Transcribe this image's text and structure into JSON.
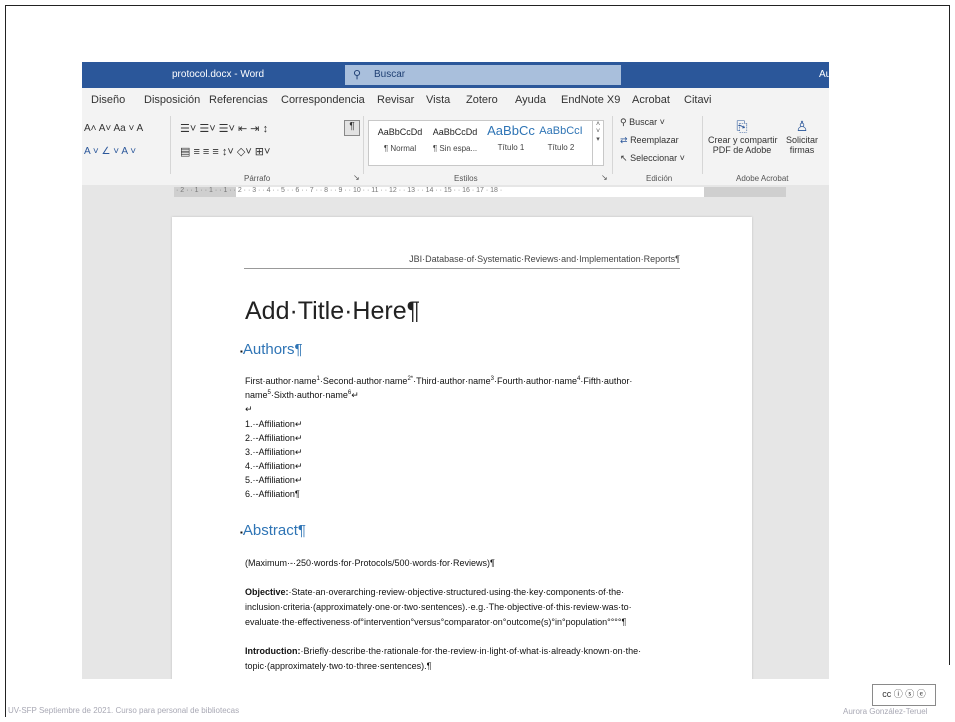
{
  "titlebar": {
    "doc_name": "protocol.docx - Word",
    "search_placeholder": "Buscar",
    "user_initial": "Au"
  },
  "tabs": [
    "Diseño",
    "Disposición",
    "Referencias",
    "Correspondencia",
    "Revisar",
    "Vista",
    "Zotero",
    "Ayuda",
    "EndNote X9",
    "Acrobat",
    "Citavi"
  ],
  "ribbon": {
    "font_row1": "A˄ A˅  Aa ˅  A",
    "font_row2": "A ˅  ∠ ˅  A ˅",
    "para_group": "Párrafo",
    "styles": [
      {
        "preview": "AaBbCcDd",
        "name": "¶ Normal"
      },
      {
        "preview": "AaBbCcDd",
        "name": "¶ Sin espa..."
      },
      {
        "preview": "AaBbCc",
        "name": "Título 1"
      },
      {
        "preview": "AaBbCcI",
        "name": "Título 2"
      }
    ],
    "styles_group": "Estilos",
    "edit": {
      "find": "Buscar",
      "replace": "Reemplazar",
      "select": "Seleccionar",
      "group": "Edición"
    },
    "acrobat": {
      "create_line1": "Crear y compartir",
      "create_line2": "PDF de Adobe",
      "request_line1": "Solicitar",
      "request_line2": "firmas",
      "group": "Adobe Acrobat"
    }
  },
  "ruler": {
    "ticks": "· 2 · · 1 · · 1 · · 1 · · 2 · · 3 · · 4 · · 5 · · 6 · · 7 · · 8 · · 9 · · 10 · · 11 · · 12 · · 13 · · 14 · · 15 · · 16 · 17 · 18 ·"
  },
  "document": {
    "header": "JBI·Database·of·Systematic·Reviews·and·Implementation·Reports¶",
    "title": "Add·Title·Here¶",
    "authors_heading": "Authors¶",
    "authors_line1_parts": [
      "First·author·name",
      "1",
      "·Second·author·name",
      "2*",
      "·Third·author·name",
      "3",
      "·Fourth·author·name",
      "4",
      "·Fifth·author·"
    ],
    "authors_line2_parts": [
      "name",
      "5",
      "·Sixth·author·name",
      "6",
      "↵"
    ],
    "blank": "↵",
    "affiliations": [
      "1.·-Affiliation↵",
      "2.·-Affiliation↵",
      "3.·-Affiliation↵",
      "4.·-Affiliation↵",
      "5.·-Affiliation↵",
      "6.·-Affiliation¶"
    ],
    "abstract_heading": "Abstract¶",
    "max_words": "(Maximum·-·250·words·for·Protocols/500·words·for·Reviews)¶",
    "objective_label": "Objective:",
    "objective_lines": [
      "·State·an·overarching·review·objective·structured·using·the·key·components·of·the·",
      "inclusion·criteria·(approximately·one·or·two·sentences).·e.g.·The·objective·of·this·review·was·to·",
      "evaluate·the·effectiveness·of°intervention°versus°comparator·on°outcome(s)°in°population°°°°¶"
    ],
    "intro_label": "Introduction:",
    "intro_lines": [
      "·Briefly·describe·the·rationale·for·the·review·in·light·of·what·is·already·known·on·the·",
      "topic·(approximately·two·to·three·sentences).¶"
    ]
  },
  "footer": {
    "left": "UV-SFP Septiembre de 2021. Curso para personal de bibliotecas",
    "right": "Aurora González-Teruel",
    "cc": "cc ⓘ ⓢ ⓔ",
    "cc_sub": "BY NC ND"
  }
}
